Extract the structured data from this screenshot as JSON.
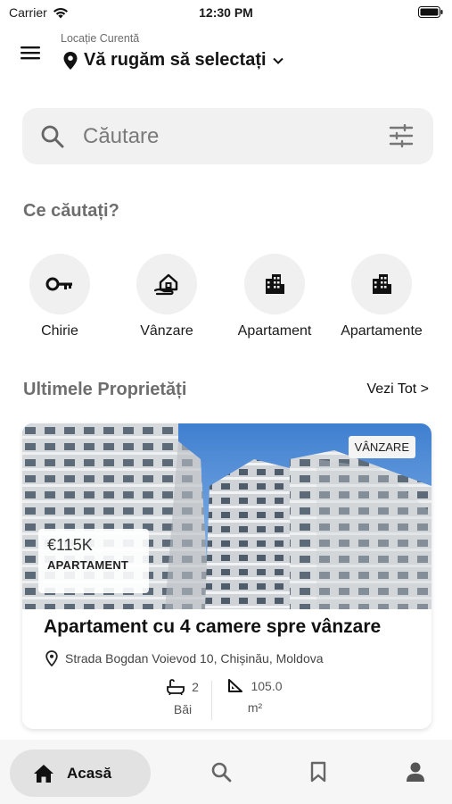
{
  "status": {
    "carrier": "Carrier",
    "time": "12:30 PM"
  },
  "header": {
    "location_caption": "Locație Curentă",
    "location_value": "Vă rugăm să selectați"
  },
  "search": {
    "placeholder": "Căutare"
  },
  "categories_title": "Ce căutați?",
  "categories": [
    {
      "label": "Chirie",
      "icon": "key-icon"
    },
    {
      "label": "Vânzare",
      "icon": "house-hand-icon"
    },
    {
      "label": "Apartament",
      "icon": "building-icon"
    },
    {
      "label": "Apartamente",
      "icon": "building-icon"
    }
  ],
  "latest": {
    "title": "Ultimele Proprietăți",
    "see_all": "Vezi Tot >"
  },
  "property": {
    "badge": "VÂNZARE",
    "price": "€115K",
    "type": "APARTAMENT",
    "title": "Apartament cu 4 camere spre vânzare",
    "address": "Strada Bogdan Voievod 10, Chișinău, Moldova",
    "baths_value": "2",
    "baths_label": "Băi",
    "area_value": "105.0",
    "area_label": "m²"
  },
  "nav": {
    "home_label": "Acasă"
  },
  "colors": {
    "accent_surface": "#f1f1f1",
    "nav_active": "#e2e2e2",
    "sky": "#5a8fd6"
  }
}
